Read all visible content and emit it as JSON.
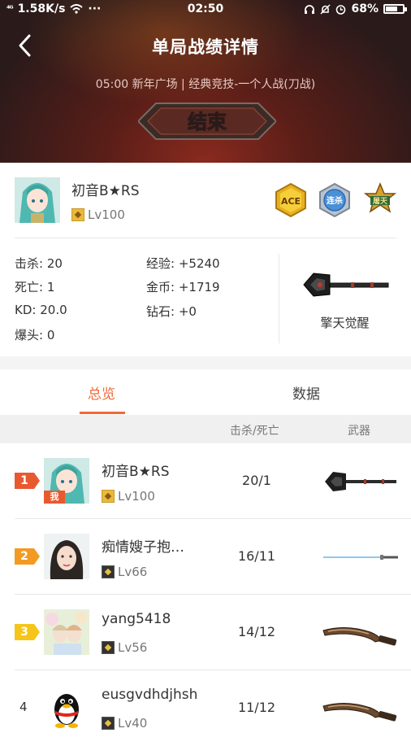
{
  "status_bar": {
    "signal": "⁴ᴳ",
    "speed": "1.58K/s",
    "more": "···",
    "time": "02:50",
    "battery_percent": "68%",
    "battery_level": 0.68
  },
  "header": {
    "title": "单局战绩详情",
    "mode_info": "05:00 新年广场 | 经典竞技-一个人战(刀战)",
    "result_badge": "结束"
  },
  "player": {
    "name": "初音B★RS",
    "level": "Lv100",
    "medals": [
      {
        "icon": "ace-medal",
        "label": "ACE"
      },
      {
        "icon": "streak-medal",
        "label": "连杀"
      },
      {
        "icon": "survive-medal",
        "label": "屠天"
      }
    ],
    "stats_left": [
      {
        "label": "击杀:",
        "value": "20"
      },
      {
        "label": "死亡:",
        "value": "1"
      },
      {
        "label": "KD:",
        "value": "20.0"
      },
      {
        "label": "爆头:",
        "value": "0"
      }
    ],
    "stats_right": [
      {
        "label": "经验:",
        "value": "+5240"
      },
      {
        "label": "金币:",
        "value": "+1719"
      },
      {
        "label": "钻石:",
        "value": "+0"
      }
    ],
    "weapon": "擎天觉醒"
  },
  "tabs": [
    {
      "label": "总览",
      "active": true
    },
    {
      "label": "数据",
      "active": false
    }
  ],
  "table": {
    "col_kd": "击杀/死亡",
    "col_weapon": "武器",
    "me_tag": "我",
    "rows": [
      {
        "rank": "1",
        "name": "初音B★RS",
        "level": "Lv100",
        "kd": "20/1",
        "rank_color": "#e8592f",
        "weapon": "shovel-axe"
      },
      {
        "rank": "2",
        "name": "痴情嫂子抱…",
        "level": "Lv66",
        "kd": "16/11",
        "rank_color": "#f39a22",
        "weapon": "light-sword"
      },
      {
        "rank": "3",
        "name": "yang5418",
        "level": "Lv56",
        "kd": "14/12",
        "rank_color": "#f5c518",
        "weapon": "kukri-knife"
      },
      {
        "rank": "4",
        "name": "eusgvdhdjhsh",
        "level": "Lv40",
        "kd": "11/12",
        "rank_color": "",
        "weapon": "kukri-knife"
      }
    ]
  },
  "colors": {
    "accent": "#ef6a3a",
    "rank1": "#e8592f",
    "rank2": "#f39a22",
    "rank3": "#f5c518"
  }
}
